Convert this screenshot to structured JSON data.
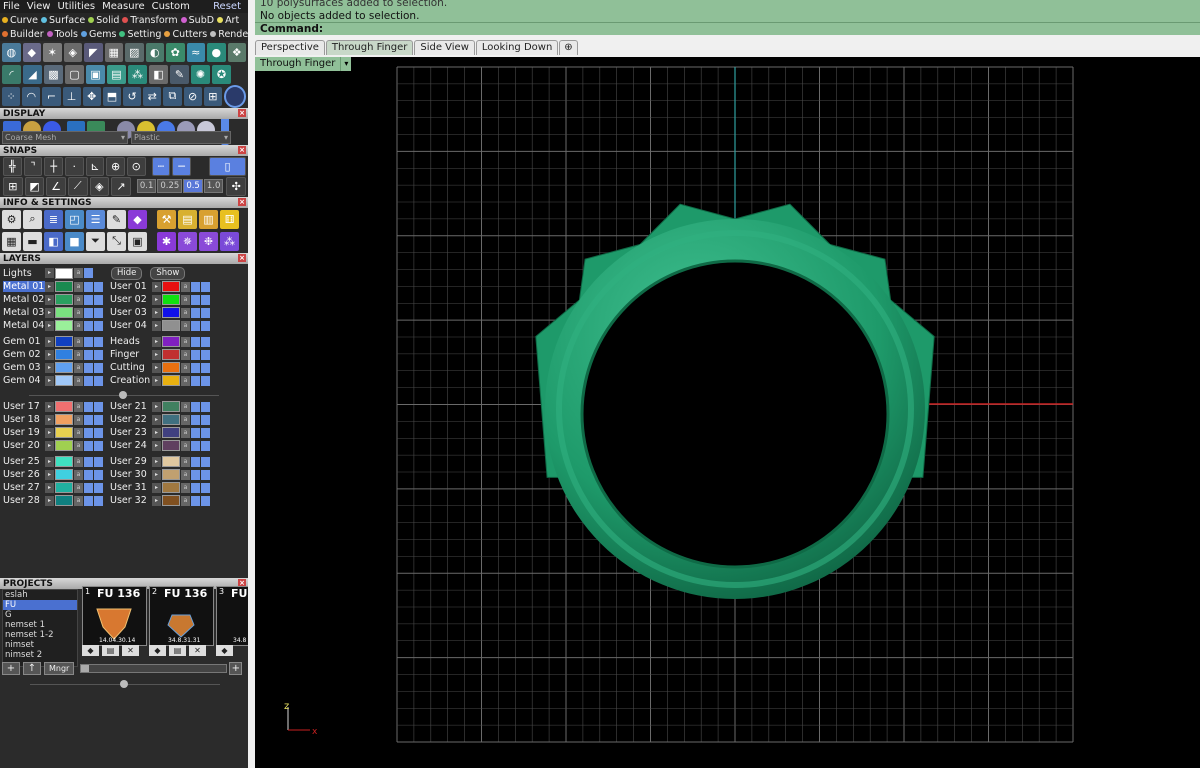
{
  "menu": {
    "items": [
      "File",
      "View",
      "Utilities",
      "Measure",
      "Custom"
    ],
    "reset": "Reset"
  },
  "plugins": {
    "row1": [
      {
        "label": "Curve",
        "color": "#e8b020"
      },
      {
        "label": "Surface",
        "color": "#60c0e0"
      },
      {
        "label": "Solid",
        "color": "#a0d050"
      },
      {
        "label": "Transform",
        "color": "#e05050"
      },
      {
        "label": "SubD",
        "color": "#d060d0"
      },
      {
        "label": "Art",
        "color": "#e8e060"
      }
    ],
    "row2": [
      {
        "label": "Builder",
        "color": "#e07030"
      },
      {
        "label": "Tools",
        "color": "#c060c0"
      },
      {
        "label": "Gems",
        "color": "#60a0e0"
      },
      {
        "label": "Setting",
        "color": "#40c080"
      },
      {
        "label": "Cutters",
        "color": "#e8a040"
      },
      {
        "label": "Render",
        "color": "#c0c0c0"
      }
    ]
  },
  "sections": {
    "display": "DISPLAY",
    "snaps": "SNAPS",
    "info": "INFO & SETTINGS",
    "layers": "LAYERS",
    "projects": "PROJECTS"
  },
  "display": {
    "mesh": "Coarse Mesh",
    "material": "Plastic"
  },
  "snaps": {
    "values": [
      "0.1",
      "0.25",
      "0.5",
      "1.0"
    ]
  },
  "layers": {
    "lights": "Lights",
    "hide": "Hide",
    "show": "Show",
    "groups": [
      {
        "left": [
          {
            "name": "Metal 01",
            "color": "#1a8a50"
          },
          {
            "name": "Metal 02",
            "color": "#2aa060"
          },
          {
            "name": "Metal 03",
            "color": "#7ae080"
          },
          {
            "name": "Metal 04",
            "color": "#9af09a"
          }
        ],
        "right": [
          {
            "name": "User 01",
            "color": "#e81010"
          },
          {
            "name": "User 02",
            "color": "#10e010"
          },
          {
            "name": "User 03",
            "color": "#1010e8"
          },
          {
            "name": "User 04",
            "color": "#909090"
          }
        ]
      },
      {
        "left": [
          {
            "name": "Gem 01",
            "color": "#1040c0"
          },
          {
            "name": "Gem 02",
            "color": "#3080e0"
          },
          {
            "name": "Gem 03",
            "color": "#60a0f0"
          },
          {
            "name": "Gem 04",
            "color": "#a0c8f8"
          }
        ],
        "right": [
          {
            "name": "Heads",
            "color": "#8020c0"
          },
          {
            "name": "Finger",
            "color": "#c03030"
          },
          {
            "name": "Cutting",
            "color": "#e87010"
          },
          {
            "name": "Creation",
            "color": "#e8b010"
          }
        ]
      },
      {
        "left": [
          {
            "name": "User 17",
            "color": "#f07070"
          },
          {
            "name": "User 18",
            "color": "#f0a060"
          },
          {
            "name": "User 19",
            "color": "#e8d050"
          },
          {
            "name": "User 20",
            "color": "#a0d050"
          }
        ],
        "right": [
          {
            "name": "User 21",
            "color": "#408060"
          },
          {
            "name": "User 22",
            "color": "#407080"
          },
          {
            "name": "User 23",
            "color": "#404080"
          },
          {
            "name": "User 24",
            "color": "#604060"
          }
        ]
      },
      {
        "left": [
          {
            "name": "User 25",
            "color": "#40e0c0"
          },
          {
            "name": "User 26",
            "color": "#40d0e0"
          },
          {
            "name": "User 27",
            "color": "#20b0a0"
          },
          {
            "name": "User 28",
            "color": "#108080"
          }
        ],
        "right": [
          {
            "name": "User 29",
            "color": "#e0c8a0"
          },
          {
            "name": "User 30",
            "color": "#c0a070"
          },
          {
            "name": "User 31",
            "color": "#a07840"
          },
          {
            "name": "User 32",
            "color": "#805020"
          }
        ]
      }
    ]
  },
  "projects": {
    "items": [
      "eslah",
      "FU",
      "G",
      "nemset 1",
      "nemset 1-2",
      "nimset",
      "nimset 2"
    ],
    "selected": "FU",
    "thumbs": [
      {
        "num": "1",
        "title": "FU 136",
        "caption": "14.04.30.14"
      },
      {
        "num": "2",
        "title": "FU 136",
        "caption": "34.8.31.31"
      },
      {
        "num": "3",
        "title": "FU",
        "caption": "34.8"
      }
    ],
    "mgr": "Mngr"
  },
  "command": {
    "line1": "10 polysurfaces added to selection.",
    "line2": "No objects added to selection.",
    "prompt": "Command:"
  },
  "viewport": {
    "tabs": [
      "Perspective",
      "Through Finger",
      "Side View",
      "Looking Down"
    ],
    "active": "Through Finger",
    "label": "Through Finger",
    "axis_z": "z",
    "axis_x": "x"
  },
  "colors": {
    "ring": "#1e9a6a",
    "grid": "#4a4a4a",
    "axis_x": "#c82020",
    "axis_y": "#30a0a0"
  }
}
